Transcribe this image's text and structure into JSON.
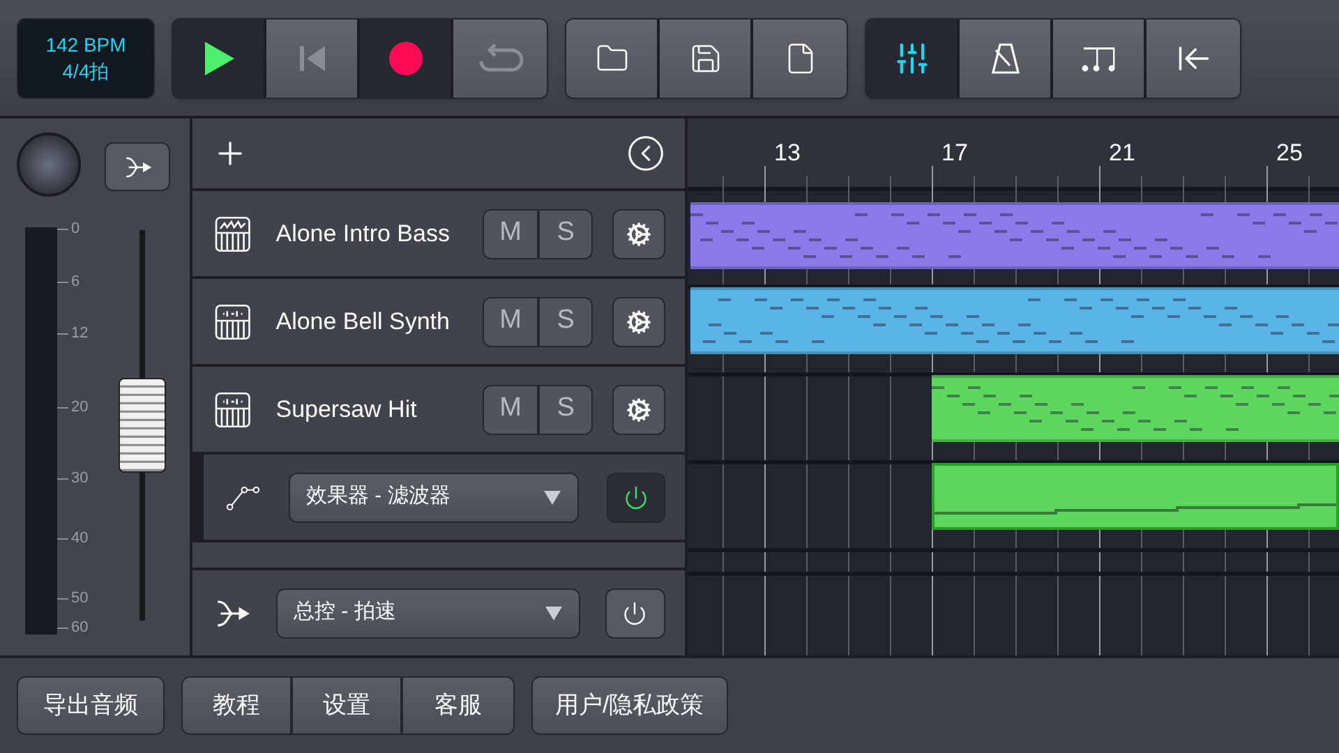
{
  "tempo": {
    "bpm": "142 BPM",
    "meter": "4/4拍"
  },
  "transport": [
    {
      "kind": "play"
    },
    {
      "kind": "rewind"
    },
    {
      "kind": "record"
    },
    {
      "kind": "loop"
    }
  ],
  "file_tools": [
    {
      "kind": "open"
    },
    {
      "kind": "save"
    },
    {
      "kind": "new"
    }
  ],
  "view_tools": [
    {
      "kind": "mixer",
      "selected": true
    },
    {
      "kind": "metronome",
      "selected": false
    },
    {
      "kind": "notes",
      "selected": false
    },
    {
      "kind": "collapse",
      "selected": false
    }
  ],
  "mixer": {
    "level": 0.5,
    "scale": [
      "0",
      "6",
      "12",
      "20",
      "30",
      "40",
      "50",
      "60"
    ]
  },
  "tracks": [
    {
      "kind": "instrument",
      "name": "Alone Intro Bass",
      "mute": "M",
      "solo": "S"
    },
    {
      "kind": "instrument",
      "name": "Alone Bell Synth",
      "mute": "M",
      "solo": "S"
    },
    {
      "kind": "instrument",
      "name": "Supersaw Hit",
      "mute": "M",
      "solo": "S"
    },
    {
      "kind": "automation",
      "value": "效果器 - 滤波器",
      "on": true
    }
  ],
  "master": {
    "value": "总控 - 拍速",
    "on": false
  },
  "ruler": [
    "13",
    "17",
    "21",
    "25"
  ],
  "lanes": [
    {
      "clip": {
        "kind": "notes",
        "color": "#8a7be8"
      }
    },
    {
      "clip": {
        "kind": "notes",
        "color": "#5ab4e8"
      }
    },
    {
      "clip": {
        "kind": "notes",
        "color": "#5cd65c"
      }
    },
    {
      "clip": {
        "kind": "automation",
        "color": "#5cd65c"
      }
    }
  ],
  "footer": {
    "export": "导出音频",
    "help": [
      "教程",
      "设置",
      "客服"
    ],
    "policy": "用户/隐私政策"
  }
}
